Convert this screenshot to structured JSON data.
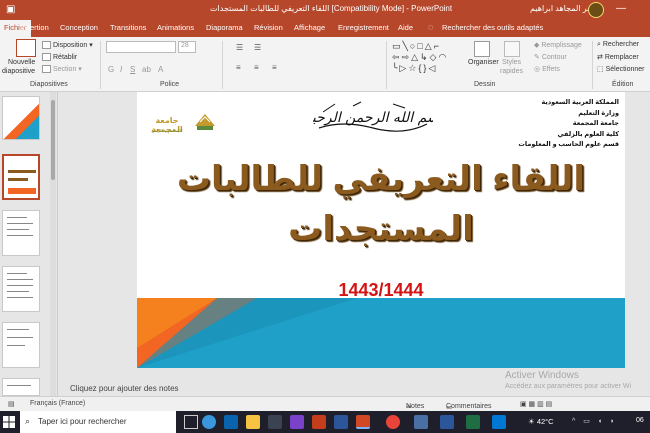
{
  "window": {
    "title": "اللقاء التعريفي للطالبات المستجدات [Compatibility Mode]  -  PowerPoint",
    "user": "هاجر المجاهد ابراهيم"
  },
  "tabs": [
    "Fichier",
    "Insertion",
    "Conception",
    "Transitions",
    "Animations",
    "Diaporama",
    "Révision",
    "Affichage",
    "Enregistrement",
    "Aide"
  ],
  "tell_me": "Rechercher des outils adaptés",
  "ribbon": {
    "diapositives": {
      "nouvelle": "Nouvelle",
      "diapositive": "diapositive",
      "disposition": "Disposition",
      "retablir": "Rétablir",
      "section": "Section",
      "group": "Diapositives"
    },
    "police": {
      "size": "28",
      "group": "Police"
    },
    "dessin": {
      "organiser": "Organiser",
      "styles": "Styles",
      "rapides": "rapides",
      "remplissage": "Remplissage",
      "contour": "Contour",
      "effets": "Effets",
      "group": "Dessin"
    },
    "edition": {
      "rechercher": "Rechercher",
      "remplacer": "Remplacer",
      "selectionner": "Sélectionner",
      "group": "Édition"
    }
  },
  "slide": {
    "info_lines": [
      "المملكة العربية السعودية",
      "وزارة التعليم",
      "جامعة المجمعة",
      "كلية العلوم بالزلفي",
      "قسم علوم الحاسب و المعلومات"
    ],
    "basmala": "بسم الله الرحمن الرحيم",
    "logo_name": "جامعة المجمعة",
    "logo_sub": "كلية العلوم بالزلفي",
    "title_line1": "اللقاء  التعريفي للطالبات",
    "title_line2": "المستجدات",
    "year": "1443/1444",
    "colors": {
      "orange": "#f26522",
      "blue": "#1ea0c8",
      "title_brown": "#8b5a1e",
      "year_red": "#d41414"
    }
  },
  "notes_placeholder": "Cliquez pour ajouter des notes",
  "watermark": {
    "line1": "Activer Windows",
    "line2": "Accédez aux paramètres pour activer Wi"
  },
  "status": {
    "language": "Français (France)",
    "notes": "Notes",
    "comments": "Commentaires"
  },
  "taskbar": {
    "search": "Taper ici pour rechercher",
    "temperature": "42°C",
    "clock": "06"
  }
}
